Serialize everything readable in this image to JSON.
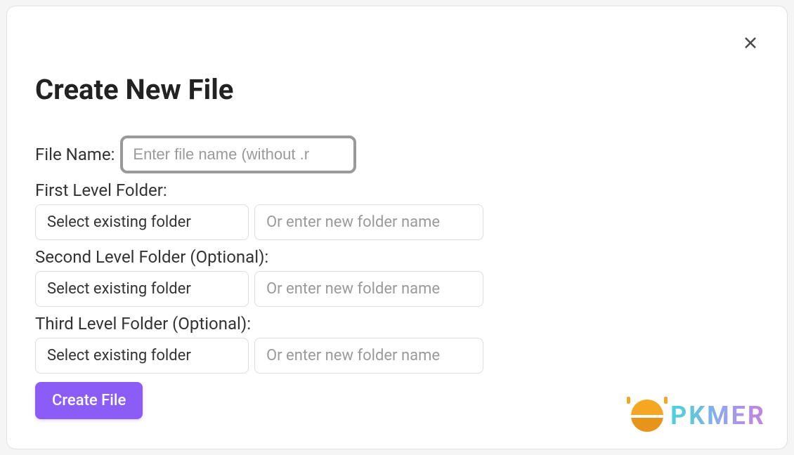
{
  "modal": {
    "title": "Create New File",
    "fileNameLabel": "File Name:",
    "fileNamePlaceholder": "Enter file name (without .r",
    "folders": {
      "first": {
        "label": "First Level Folder:",
        "selectText": "Select existing folder",
        "inputPlaceholder": "Or enter new folder name"
      },
      "second": {
        "label": "Second Level Folder (Optional):",
        "selectText": "Select existing folder",
        "inputPlaceholder": "Or enter new folder name"
      },
      "third": {
        "label": "Third Level Folder (Optional):",
        "selectText": "Select existing folder",
        "inputPlaceholder": "Or enter new folder name"
      }
    },
    "createButton": "Create File"
  },
  "watermark": {
    "text": "PKMER"
  }
}
